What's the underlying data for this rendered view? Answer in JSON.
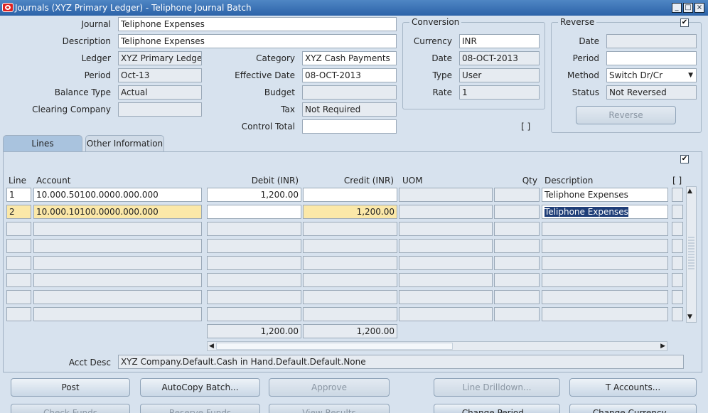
{
  "window": {
    "title": "Journals (XYZ Primary Ledger) - Teliphone Journal Batch",
    "controls": [
      "_",
      "□",
      "×"
    ]
  },
  "header": {
    "journal_label": "Journal",
    "journal": "Teliphone Expenses",
    "description_label": "Description",
    "description": "Teliphone Expenses",
    "ledger_label": "Ledger",
    "ledger": "XYZ Primary Ledger",
    "period_label": "Period",
    "period": "Oct-13",
    "balance_type_label": "Balance Type",
    "balance_type": "Actual",
    "clearing_company_label": "Clearing Company",
    "clearing_company": "",
    "category_label": "Category",
    "category": "XYZ Cash Payments",
    "effective_date_label": "Effective Date",
    "effective_date": "08-OCT-2013",
    "budget_label": "Budget",
    "budget": "",
    "tax_label": "Tax",
    "tax": "Not Required",
    "control_total_label": "Control Total",
    "control_total": ""
  },
  "conversion": {
    "title": "Conversion",
    "currency_label": "Currency",
    "currency": "INR",
    "date_label": "Date",
    "date": "08-OCT-2013",
    "type_label": "Type",
    "type": "User",
    "rate_label": "Rate",
    "rate": "1"
  },
  "reverse": {
    "title": "Reverse",
    "checkbox": "✔",
    "date_label": "Date",
    "date": "",
    "period_label": "Period",
    "period": "",
    "method_label": "Method",
    "method": "Switch Dr/Cr",
    "status_label": "Status",
    "status": "Not Reversed",
    "button": "Reverse"
  },
  "folder_indicator": "[ ]",
  "tabs": [
    {
      "label": "Lines",
      "active": true
    },
    {
      "label": "Other Information",
      "active": false
    }
  ],
  "lines": {
    "top_checkbox": "✔",
    "columns": {
      "line": "Line",
      "account": "Account",
      "debit": "Debit (INR)",
      "credit": "Credit (INR)",
      "uom": "UOM",
      "qty": "Qty",
      "description": "Description",
      "dff": "[ ]"
    },
    "rows": [
      {
        "line": "1",
        "account": "10.000.50100.0000.000.000",
        "debit": "1,200.00",
        "credit": "",
        "uom": "",
        "qty": "",
        "description": "Teliphone Expenses"
      },
      {
        "line": "2",
        "account": "10.000.10100.0000.000.000",
        "debit": "",
        "credit": "1,200.00",
        "uom": "",
        "qty": "",
        "description": "Teliphone Expenses"
      },
      {
        "line": "",
        "account": "",
        "debit": "",
        "credit": "",
        "uom": "",
        "qty": "",
        "description": ""
      },
      {
        "line": "",
        "account": "",
        "debit": "",
        "credit": "",
        "uom": "",
        "qty": "",
        "description": ""
      },
      {
        "line": "",
        "account": "",
        "debit": "",
        "credit": "",
        "uom": "",
        "qty": "",
        "description": ""
      },
      {
        "line": "",
        "account": "",
        "debit": "",
        "credit": "",
        "uom": "",
        "qty": "",
        "description": ""
      },
      {
        "line": "",
        "account": "",
        "debit": "",
        "credit": "",
        "uom": "",
        "qty": "",
        "description": ""
      },
      {
        "line": "",
        "account": "",
        "debit": "",
        "credit": "",
        "uom": "",
        "qty": "",
        "description": ""
      }
    ],
    "total_debit": "1,200.00",
    "total_credit": "1,200.00",
    "acct_desc_label": "Acct Desc",
    "acct_desc": "XYZ Company.Default.Cash in Hand.Default.Default.None"
  },
  "buttons_row1": [
    {
      "label": "Post",
      "enabled": true
    },
    {
      "label": "AutoCopy Batch...",
      "enabled": true
    },
    {
      "label": "Approve",
      "enabled": false
    },
    {
      "label": "Line Drilldown...",
      "enabled": false
    },
    {
      "label": "T Accounts...",
      "enabled": true
    }
  ],
  "buttons_row2": [
    {
      "label": "Check Funds",
      "enabled": false
    },
    {
      "label": "Reserve Funds",
      "enabled": false
    },
    {
      "label": "View Results",
      "enabled": false
    },
    {
      "label": "Change Period...",
      "enabled": true
    },
    {
      "label": "Change Currency...",
      "enabled": true
    }
  ],
  "colors": {
    "background": "#d7e2ee",
    "field_disabled": "#e6ebf1",
    "field_current": "#fbe8a8",
    "selection": "#1f3e78",
    "titlebar": "#2c63a8"
  }
}
